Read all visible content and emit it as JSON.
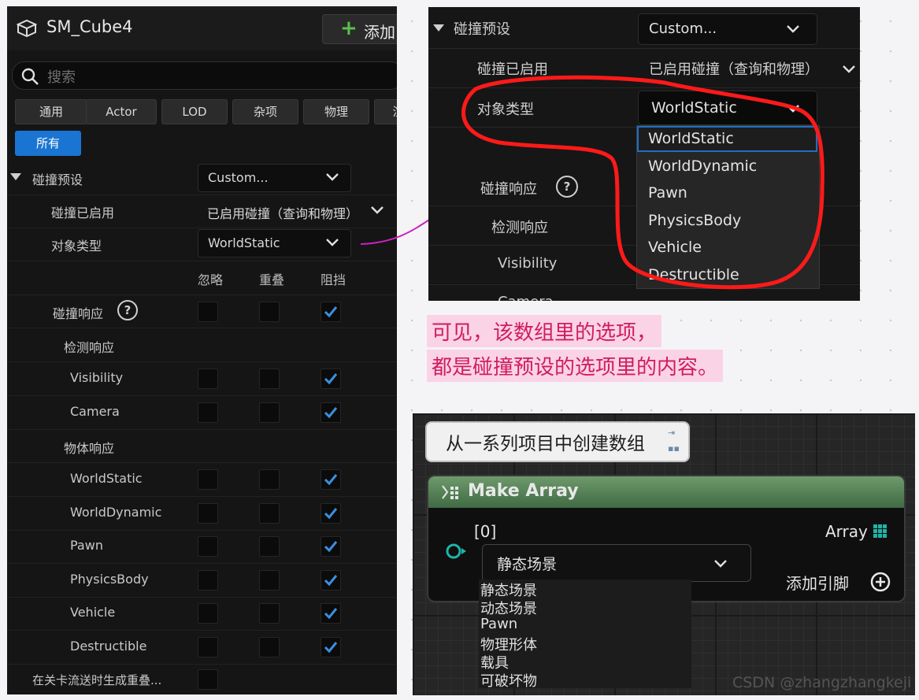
{
  "left_panel": {
    "title": "SM_Cube4",
    "add_button": "添加",
    "search_placeholder": "搜索",
    "categories": [
      "通用",
      "Actor",
      "LOD",
      "杂项",
      "物理",
      "渲",
      "所有"
    ],
    "collision_presets_label": "碰撞预设",
    "collision_presets_value": "Custom...",
    "collision_enabled_label": "碰撞已启用",
    "collision_enabled_value": "已启用碰撞（查询和物理）",
    "object_type_label": "对象类型",
    "object_type_value": "WorldStatic",
    "columns": [
      "忽略",
      "重叠",
      "阻挡"
    ],
    "collision_responses_label": "碰撞响应",
    "trace_responses_label": "检测响应",
    "object_responses_label": "物体响应",
    "rows": [
      {
        "label": "Visibility",
        "checks": [
          false,
          false,
          true
        ]
      },
      {
        "label": "Camera",
        "checks": [
          false,
          false,
          true
        ]
      },
      {
        "label": "WorldStatic",
        "checks": [
          false,
          false,
          true
        ]
      },
      {
        "label": "WorldDynamic",
        "checks": [
          false,
          false,
          true
        ]
      },
      {
        "label": "Pawn",
        "checks": [
          false,
          false,
          true
        ]
      },
      {
        "label": "PhysicsBody",
        "checks": [
          false,
          false,
          true
        ]
      },
      {
        "label": "Vehicle",
        "checks": [
          false,
          false,
          true
        ]
      },
      {
        "label": "Destructible",
        "checks": [
          false,
          false,
          true
        ]
      }
    ],
    "overlap_label": "在关卡流送时生成重叠..."
  },
  "dropdown_shot": {
    "collision_presets_label": "碰撞预设",
    "collision_presets_value": "Custom...",
    "collision_enabled_label": "碰撞已启用",
    "collision_enabled_value": "已启用碰撞（查询和物理）",
    "object_type_label": "对象类型",
    "object_type_value": "WorldStatic",
    "collision_responses_label": "碰撞响应",
    "trace_responses_label": "检测响应",
    "visibility_label": "Visibility",
    "camera_label": "Camera",
    "options": [
      "WorldStatic",
      "WorldDynamic",
      "Pawn",
      "PhysicsBody",
      "Vehicle",
      "Destructible"
    ]
  },
  "note": {
    "line1": "可见，该数组里的选项，",
    "line2": "都是碰撞预设的选项里的内容。"
  },
  "blueprint": {
    "comment": "从一系列项目中创建数组",
    "node_title": "Make Array",
    "input_pin": "[0]",
    "output_pin": "Array",
    "selected_value": "静态场景",
    "add_pin": "添加引脚",
    "options": [
      "静态场景",
      "动态场景",
      "Pawn",
      "物理形体",
      "载具",
      "可破坏物"
    ]
  },
  "watermark": "CSDN @zhangzhangkeji",
  "colors": {
    "accent": "#1a75d2",
    "checkmark": "#3a8fe0",
    "annotation": "#ff1a1a",
    "arrow": "#d020c0",
    "note_bg": "#fbd3e6"
  }
}
